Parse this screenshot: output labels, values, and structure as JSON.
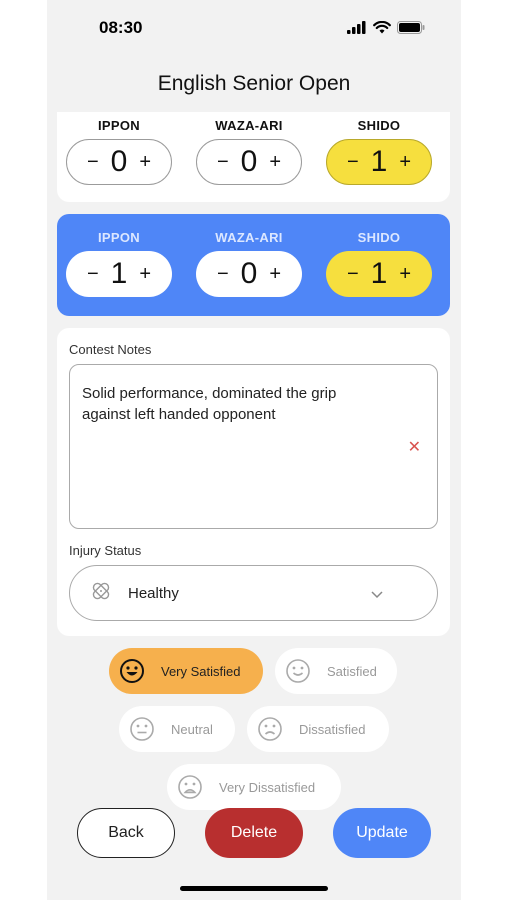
{
  "status_bar": {
    "time": "08:30",
    "icons": [
      "signal-icon",
      "wifi-icon",
      "battery-icon"
    ]
  },
  "title": "English Senior Open",
  "score_cards": [
    {
      "theme": "white",
      "columns": [
        {
          "label": "IPPON",
          "value": "0",
          "minus": "−",
          "plus": "+",
          "highlight": false
        },
        {
          "label": "WAZA-ARI",
          "value": "0",
          "minus": "−",
          "plus": "+",
          "highlight": false
        },
        {
          "label": "SHIDO",
          "value": "1",
          "minus": "−",
          "plus": "+",
          "highlight": true
        }
      ]
    },
    {
      "theme": "blue",
      "columns": [
        {
          "label": "IPPON",
          "value": "1",
          "minus": "−",
          "plus": "+",
          "highlight": false
        },
        {
          "label": "WAZA-ARI",
          "value": "0",
          "minus": "−",
          "plus": "+",
          "highlight": false
        },
        {
          "label": "SHIDO",
          "value": "1",
          "minus": "−",
          "plus": "+",
          "highlight": true
        }
      ]
    }
  ],
  "notes": {
    "label": "Contest Notes",
    "value": "Solid performance, dominated the grip against left handed opponent",
    "clear_icon": "close-icon"
  },
  "injury": {
    "label": "Injury Status",
    "value": "Healthy",
    "icon": "bandage-icon",
    "chevron_icon": "chevron-down-icon"
  },
  "satisfaction": {
    "selected": "Very Satisfied",
    "options": [
      "Very Satisfied",
      "Satisfied",
      "Neutral",
      "Dissatisfied",
      "Very Dissatisfied"
    ]
  },
  "buttons": {
    "back": "Back",
    "delete": "Delete",
    "update": "Update"
  },
  "colors": {
    "accent_blue": "#4f86f7",
    "shido_yellow": "#f6df3e",
    "selected_orange": "#f6b04d",
    "delete_red": "#b82f2f"
  }
}
